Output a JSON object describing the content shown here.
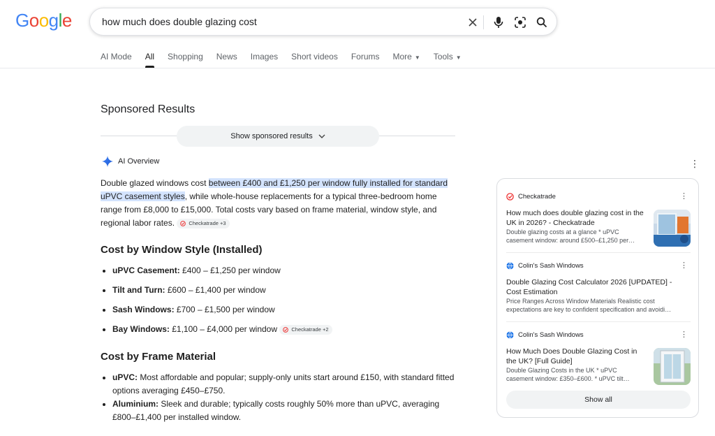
{
  "logo": {
    "letters": [
      "G",
      "o",
      "o",
      "g",
      "l",
      "e"
    ],
    "colors": [
      "#4285F4",
      "#EA4335",
      "#FBBC05",
      "#4285F4",
      "#34A853",
      "#EA4335"
    ]
  },
  "search": {
    "query": "how much does double glazing cost",
    "icons": [
      "close-icon",
      "mic-icon",
      "lens-icon",
      "search-icon"
    ]
  },
  "tabs": [
    {
      "label": "AI Mode",
      "active": false
    },
    {
      "label": "All",
      "active": true
    },
    {
      "label": "Shopping",
      "active": false
    },
    {
      "label": "News",
      "active": false
    },
    {
      "label": "Images",
      "active": false
    },
    {
      "label": "Short videos",
      "active": false
    },
    {
      "label": "Forums",
      "active": false
    },
    {
      "label": "More",
      "active": false,
      "dropdown": true
    },
    {
      "label": "Tools",
      "active": false,
      "dropdown": true
    }
  ],
  "sponsored": {
    "title": "Sponsored Results",
    "button": "Show sponsored results"
  },
  "ai_overview": {
    "label": "AI Overview",
    "intro_before": "Double glazed windows cost ",
    "intro_highlight": "between £400 and £1,250 per window fully installed for standard uPVC casement styles",
    "intro_after": ", while whole-house replacements for a typical three-bedroom home range from £8,000 to £15,000. Total costs vary based on frame material, window style, and regional labor rates.",
    "intro_chip": "Checkatrade +3",
    "section1": {
      "heading": "Cost by Window Style (Installed)",
      "items": [
        {
          "term": "uPVC Casement:",
          "text": " £400 – £1,250 per window"
        },
        {
          "term": "Tilt and Turn:",
          "text": " £600 – £1,400 per window"
        },
        {
          "term": "Sash Windows:",
          "text": " £700 – £1,500 per window"
        },
        {
          "term": "Bay Windows:",
          "text": " £1,100 – £4,000 per window",
          "chip": "Checkatrade +2"
        }
      ]
    },
    "section2": {
      "heading": "Cost by Frame Material",
      "items": [
        {
          "term": "uPVC:",
          "text": " Most affordable and popular; supply-only units start around £150, with standard fitted options averaging £450–£750."
        },
        {
          "term": "Aluminium:",
          "text": " Sleek and durable; typically costs roughly 50% more than uPVC, averaging £800–£1,400 per installed window."
        }
      ]
    }
  },
  "sources": [
    {
      "site": "Checkatrade",
      "title": "How much does double glazing cost in the UK in 2026? - Checkatrade",
      "snippet": "Double glazing costs at a glance * uPVC casement window: around £500–£1,250 per…",
      "favicon": "checkatrade-icon",
      "thumb": true
    },
    {
      "site": "Colin's Sash Windows",
      "title": "Double Glazing Cost Calculator 2026 [UPDATED] - Cost Estimation",
      "snippet": "Price Ranges Across Window Materials Realistic cost expectations are key to confident specification and avoidi…",
      "favicon": "globe-icon",
      "thumb": false
    },
    {
      "site": "Colin's Sash Windows",
      "title": "How Much Does Double Glazing Cost in the UK? [Full Guide]",
      "snippet": "Double Glazing Costs in the UK * uPVC casement window: £350–£600. * uPVC tilt…",
      "favicon": "globe-icon",
      "thumb": true
    }
  ],
  "show_all": "Show all"
}
